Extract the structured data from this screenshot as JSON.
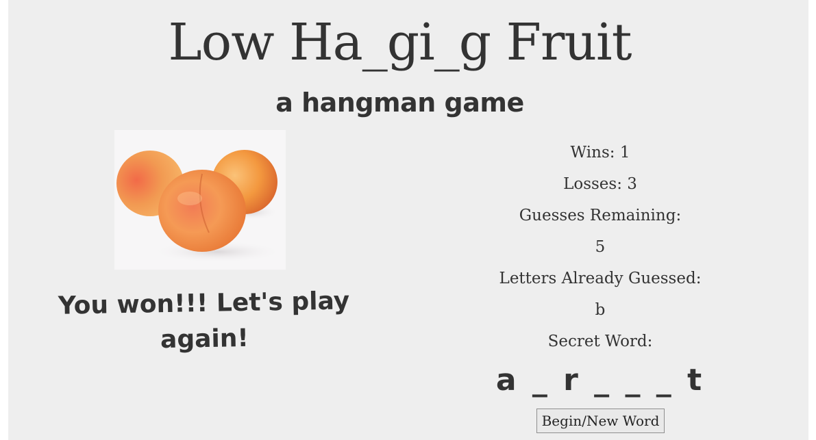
{
  "header": {
    "title": "Low Ha_gi_g Fruit",
    "subtitle": "a hangman game"
  },
  "fruit_image": {
    "icon": "apricots-image",
    "colors": {
      "fruit_main": "#f4a24e",
      "fruit_blush": "#e8633e",
      "background": "#f7f6f7"
    }
  },
  "game": {
    "message": "You won!!! Let's play again!",
    "wins_label": "Wins: 1",
    "losses_label": "Losses: 3",
    "guesses_label": "Guesses Remaining:",
    "guesses_value": "5",
    "letters_label": "Letters Already Guessed:",
    "letters_value": "b",
    "secret_label": "Secret Word:",
    "secret_word": "a _ r _ _ _ t",
    "new_word_button": "Begin/New Word"
  }
}
